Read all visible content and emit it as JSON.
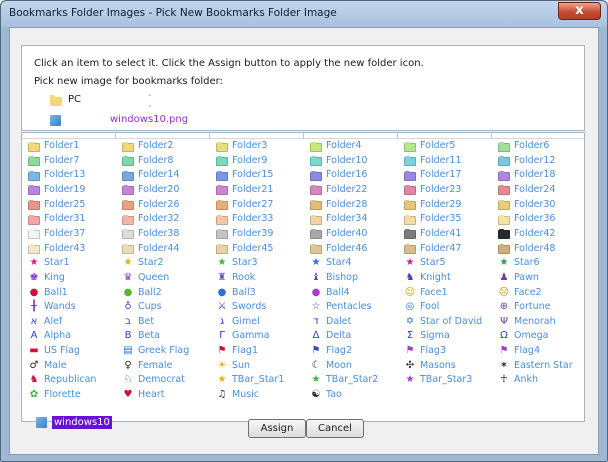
{
  "window": {
    "title": "Bookmarks Folder Images - Pick New Bookmarks Folder Image",
    "close_label": "x"
  },
  "info": {
    "instruction": "Click an item to select it. Click the Assign button to apply the new folder icon.",
    "prompt": "Pick new image for bookmarks folder:",
    "pc_label": "PC",
    "pc_dash": "---",
    "file_label": "windows10.png"
  },
  "grid": {
    "columns": 6,
    "items": [
      {
        "label": "Folder1",
        "icon": "folder-icon",
        "color": "#f3d877"
      },
      {
        "label": "Folder2",
        "icon": "folder-icon",
        "color": "#f3d877"
      },
      {
        "label": "Folder3",
        "icon": "folder-icon",
        "color": "#e6e07a"
      },
      {
        "label": "Folder4",
        "icon": "folder-icon",
        "color": "#c9e67a"
      },
      {
        "label": "Folder5",
        "icon": "folder-icon",
        "color": "#b6e68c"
      },
      {
        "label": "Folder6",
        "icon": "folder-icon",
        "color": "#9ee09a"
      },
      {
        "label": "Folder7",
        "icon": "folder-icon",
        "color": "#8ed89c"
      },
      {
        "label": "Folder8",
        "icon": "folder-icon",
        "color": "#7fd8a8"
      },
      {
        "label": "Folder9",
        "icon": "folder-icon",
        "color": "#7ad8bc"
      },
      {
        "label": "Folder10",
        "icon": "folder-icon",
        "color": "#7ad8cc"
      },
      {
        "label": "Folder11",
        "icon": "folder-icon",
        "color": "#7ad2dc"
      },
      {
        "label": "Folder12",
        "icon": "folder-icon",
        "color": "#7ac8e0"
      },
      {
        "label": "Folder13",
        "icon": "folder-icon",
        "color": "#7ab8e4"
      },
      {
        "label": "Folder14",
        "icon": "folder-icon",
        "color": "#7aa6e6"
      },
      {
        "label": "Folder15",
        "icon": "folder-icon",
        "color": "#7a96e6"
      },
      {
        "label": "Folder16",
        "icon": "folder-icon",
        "color": "#8a8ae6"
      },
      {
        "label": "Folder17",
        "icon": "folder-icon",
        "color": "#9a86e6"
      },
      {
        "label": "Folder18",
        "icon": "folder-icon",
        "color": "#aa86e6"
      },
      {
        "label": "Folder19",
        "icon": "folder-icon",
        "color": "#b886e0"
      },
      {
        "label": "Folder20",
        "icon": "folder-icon",
        "color": "#c486d8"
      },
      {
        "label": "Folder21",
        "icon": "folder-icon",
        "color": "#d086cc"
      },
      {
        "label": "Folder22",
        "icon": "folder-icon",
        "color": "#da86bc"
      },
      {
        "label": "Folder23",
        "icon": "folder-icon",
        "color": "#e286a8"
      },
      {
        "label": "Folder24",
        "icon": "folder-icon",
        "color": "#e68a94"
      },
      {
        "label": "Folder25",
        "icon": "folder-icon",
        "color": "#e69686"
      },
      {
        "label": "Folder26",
        "icon": "folder-icon",
        "color": "#e6a47e"
      },
      {
        "label": "Folder27",
        "icon": "folder-icon",
        "color": "#e6b07a"
      },
      {
        "label": "Folder28",
        "icon": "folder-icon",
        "color": "#e6bc7a"
      },
      {
        "label": "Folder29",
        "icon": "folder-icon",
        "color": "#e6c67a"
      },
      {
        "label": "Folder30",
        "icon": "folder-icon",
        "color": "#e6ce7a"
      },
      {
        "label": "Folder31",
        "icon": "folder-icon",
        "color": "#f2a6a6"
      },
      {
        "label": "Folder32",
        "icon": "folder-icon",
        "color": "#f2b6a6"
      },
      {
        "label": "Folder33",
        "icon": "folder-icon",
        "color": "#f2c6a6"
      },
      {
        "label": "Folder34",
        "icon": "folder-icon",
        "color": "#f2d2a6"
      },
      {
        "label": "Folder35",
        "icon": "folder-icon",
        "color": "#f2dca6"
      },
      {
        "label": "Folder36",
        "icon": "folder-icon",
        "color": "#f2e4a6"
      },
      {
        "label": "Folder37",
        "icon": "folder-icon",
        "color": "#f4f4f4"
      },
      {
        "label": "Folder38",
        "icon": "folder-icon",
        "color": "#dcdcdc"
      },
      {
        "label": "Folder39",
        "icon": "folder-icon",
        "color": "#c4c4c4"
      },
      {
        "label": "Folder40",
        "icon": "folder-icon",
        "color": "#a8a8a8"
      },
      {
        "label": "Folder41",
        "icon": "folder-icon",
        "color": "#7c7c7c"
      },
      {
        "label": "Folder42",
        "icon": "folder-icon",
        "color": "#2a2a2a"
      },
      {
        "label": "Folder43",
        "icon": "folder-icon",
        "color": "#f2e8c8"
      },
      {
        "label": "Folder44",
        "icon": "folder-icon",
        "color": "#ecdcb4"
      },
      {
        "label": "Folder45",
        "icon": "folder-icon",
        "color": "#e6d4a4"
      },
      {
        "label": "Folder46",
        "icon": "folder-icon",
        "color": "#e0c894"
      },
      {
        "label": "Folder47",
        "icon": "folder-icon",
        "color": "#dabc88"
      },
      {
        "label": "Folder48",
        "icon": "folder-icon",
        "color": "#d2ae7c"
      },
      {
        "label": "Star1",
        "icon": "star-icon",
        "color": "#d81e8c",
        "glyph": "★"
      },
      {
        "label": "Star2",
        "icon": "star-icon",
        "color": "#e6b21e",
        "glyph": "★"
      },
      {
        "label": "Star3",
        "icon": "star-icon",
        "color": "#3cb43c",
        "glyph": "★"
      },
      {
        "label": "Star4",
        "icon": "star-icon",
        "color": "#2e6ed2",
        "glyph": "★"
      },
      {
        "label": "Star5",
        "icon": "star-icon",
        "color": "#c81ea8",
        "glyph": "★"
      },
      {
        "label": "Star6",
        "icon": "star-icon",
        "color": "#2e9e4e",
        "glyph": "★"
      },
      {
        "label": "King",
        "icon": "chess-king-icon",
        "color": "#7a2eb4",
        "glyph": "♚"
      },
      {
        "label": "Queen",
        "icon": "chess-queen-icon",
        "color": "#8a3ec4",
        "glyph": "♛"
      },
      {
        "label": "Rook",
        "icon": "chess-rook-icon",
        "color": "#5a5ab4",
        "glyph": "♜"
      },
      {
        "label": "Bishop",
        "icon": "chess-bishop-icon",
        "color": "#5a4ab4",
        "glyph": "♝"
      },
      {
        "label": "Knight",
        "icon": "chess-knight-icon",
        "color": "#4a3ea4",
        "glyph": "♞"
      },
      {
        "label": "Pawn",
        "icon": "chess-pawn-icon",
        "color": "#6a3ea4",
        "glyph": "♟"
      },
      {
        "label": "Ball1",
        "icon": "ball-icon",
        "color": "#c8143c",
        "glyph": "●"
      },
      {
        "label": "Ball2",
        "icon": "ball-icon",
        "color": "#5ab42e",
        "glyph": "●"
      },
      {
        "label": "Ball3",
        "icon": "ball-icon",
        "color": "#2e6ed2",
        "glyph": "●"
      },
      {
        "label": "Ball4",
        "icon": "ball-icon",
        "color": "#a83ec8",
        "glyph": "●"
      },
      {
        "label": "Face1",
        "icon": "smiley-face-icon",
        "color": "#d8a800",
        "glyph": "☺"
      },
      {
        "label": "Face2",
        "icon": "frowny-face-icon",
        "color": "#b49000",
        "glyph": "☹"
      },
      {
        "label": "Wands",
        "icon": "wands-icon",
        "color": "#7a2eb4",
        "glyph": "╂"
      },
      {
        "label": "Cups",
        "icon": "cups-icon",
        "color": "#5a3eb4",
        "glyph": "♁"
      },
      {
        "label": "Swords",
        "icon": "swords-icon",
        "color": "#3e4ab4",
        "glyph": "⚔"
      },
      {
        "label": "Pentacles",
        "icon": "pentacles-icon",
        "color": "#5a3ea4",
        "glyph": "☆"
      },
      {
        "label": "Fool",
        "icon": "fool-icon",
        "color": "#2e6ed2",
        "glyph": "◎"
      },
      {
        "label": "Fortune",
        "icon": "fortune-icon",
        "color": "#6a3ea4",
        "glyph": "⊕"
      },
      {
        "label": "Alef",
        "icon": "alef-icon",
        "color": "#2e3ec8",
        "glyph": "א"
      },
      {
        "label": "Bet",
        "icon": "bet-icon",
        "color": "#2e3ec8",
        "glyph": "ב"
      },
      {
        "label": "Gimel",
        "icon": "gimel-icon",
        "color": "#2e3ec8",
        "glyph": "ג"
      },
      {
        "label": "Dalet",
        "icon": "dalet-icon",
        "color": "#2e3ec8",
        "glyph": "ד"
      },
      {
        "label": "Star of David",
        "icon": "star-of-david-icon",
        "color": "#2e6ed2",
        "glyph": "✡"
      },
      {
        "label": "Menorah",
        "icon": "menorah-icon",
        "color": "#6a3ea4",
        "glyph": "Ψ"
      },
      {
        "label": "Alpha",
        "icon": "alpha-icon",
        "color": "#2e3ec8",
        "glyph": "A"
      },
      {
        "label": "Beta",
        "icon": "beta-icon",
        "color": "#2e3ec8",
        "glyph": "B"
      },
      {
        "label": "Gamma",
        "icon": "gamma-icon",
        "color": "#2e3ec8",
        "glyph": "Γ"
      },
      {
        "label": "Delta",
        "icon": "delta-icon",
        "color": "#2e3ec8",
        "glyph": "Δ"
      },
      {
        "label": "Sigma",
        "icon": "sigma-icon",
        "color": "#2e3ec8",
        "glyph": "Σ"
      },
      {
        "label": "Omega",
        "icon": "omega-icon",
        "color": "#2e3ec8",
        "glyph": "Ω"
      },
      {
        "label": "US Flag",
        "icon": "us-flag-icon",
        "color": "#c8143c",
        "glyph": "▬"
      },
      {
        "label": "Greek Flag",
        "icon": "greek-flag-icon",
        "color": "#2e6ed2",
        "glyph": "▤"
      },
      {
        "label": "Flag1",
        "icon": "flag-icon",
        "color": "#c8143c",
        "glyph": "⚑"
      },
      {
        "label": "Flag2",
        "icon": "flag-icon",
        "color": "#3e4ab4",
        "glyph": "⚑"
      },
      {
        "label": "Flag3",
        "icon": "flag-icon",
        "color": "#a83ec8",
        "glyph": "⚑"
      },
      {
        "label": "Flag4",
        "icon": "flag-icon",
        "color": "#a83ec8",
        "glyph": "⚑"
      },
      {
        "label": "Male",
        "icon": "male-icon",
        "color": "#2a2a2a",
        "glyph": "♂"
      },
      {
        "label": "Female",
        "icon": "female-icon",
        "color": "#2a2a2a",
        "glyph": "♀"
      },
      {
        "label": "Sun",
        "icon": "sun-icon",
        "color": "#d8a800",
        "glyph": "☀"
      },
      {
        "label": "Moon",
        "icon": "moon-icon",
        "color": "#2a2a2a",
        "glyph": "☾"
      },
      {
        "label": "Masons",
        "icon": "masons-icon",
        "color": "#2a2a2a",
        "glyph": "✣"
      },
      {
        "label": "Eastern Star",
        "icon": "eastern-star-icon",
        "color": "#2a2a2a",
        "glyph": "✶"
      },
      {
        "label": "Republican",
        "icon": "republican-icon",
        "color": "#c8143c",
        "glyph": "♞"
      },
      {
        "label": "Democrat",
        "icon": "democrat-icon",
        "color": "#2e3ec8",
        "glyph": "♘"
      },
      {
        "label": "TBar_Star1",
        "icon": "tbar-star-icon",
        "color": "#e6b21e",
        "glyph": "★"
      },
      {
        "label": "TBar_Star2",
        "icon": "tbar-star-icon",
        "color": "#3cb43c",
        "glyph": "★"
      },
      {
        "label": "TBar_Star3",
        "icon": "tbar-star-icon",
        "color": "#a83ec8",
        "glyph": "★"
      },
      {
        "label": "Ankh",
        "icon": "ankh-icon",
        "color": "#2a2a2a",
        "glyph": "☥"
      },
      {
        "label": "Florette",
        "icon": "florette-icon",
        "color": "#3cb43c",
        "glyph": "✿"
      },
      {
        "label": "Heart",
        "icon": "heart-icon",
        "color": "#c8143c",
        "glyph": "♥"
      },
      {
        "label": "Music",
        "icon": "music-icon",
        "color": "#2a2a2a",
        "glyph": "♫"
      },
      {
        "label": "Tao",
        "icon": "yin-yang-icon",
        "color": "#2a2a2a",
        "glyph": "☯"
      }
    ]
  },
  "selected": {
    "label": "windows10"
  },
  "buttons": {
    "assign": "Assign",
    "cancel": "Cancel"
  }
}
